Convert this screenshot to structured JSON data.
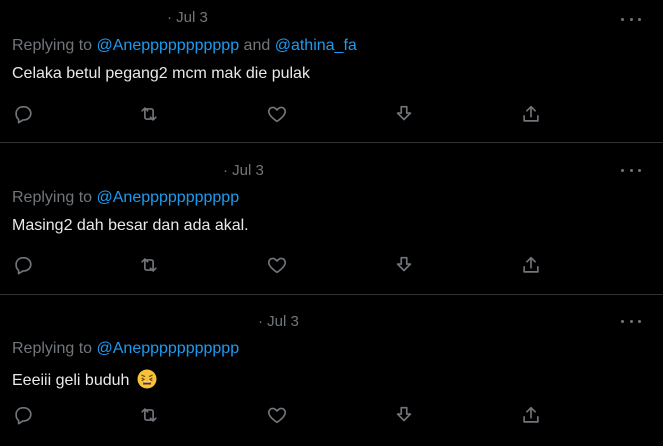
{
  "tweets": [
    {
      "date": "· Jul 3",
      "replying_prefix": "Replying to",
      "mention1": "@Aneppppppppppp",
      "and_text": "and",
      "mention2": "@athina_fa",
      "text": "Celaka betul pegang2 mcm mak die pulak"
    },
    {
      "date": "· Jul 3",
      "replying_prefix": "Replying to",
      "mention1": "@Aneppppppppppp",
      "text": "Masing2 dah besar dan ada akal."
    },
    {
      "date": "· Jul 3",
      "replying_prefix": "Replying to",
      "mention1": "@Aneppppppppppp",
      "text": "Eeeiii geli buduh",
      "emoji": "weary-face-emoji"
    }
  ],
  "icons": {
    "reply": "reply-icon",
    "retweet": "retweet-icon",
    "like": "heart-icon",
    "download": "download-icon",
    "share": "share-icon",
    "more": "more-dots-icon"
  },
  "colors": {
    "background": "#000000",
    "text": "#e7e9ea",
    "muted": "#71767b",
    "link": "#1d9bf0",
    "divider": "#2f3336"
  }
}
